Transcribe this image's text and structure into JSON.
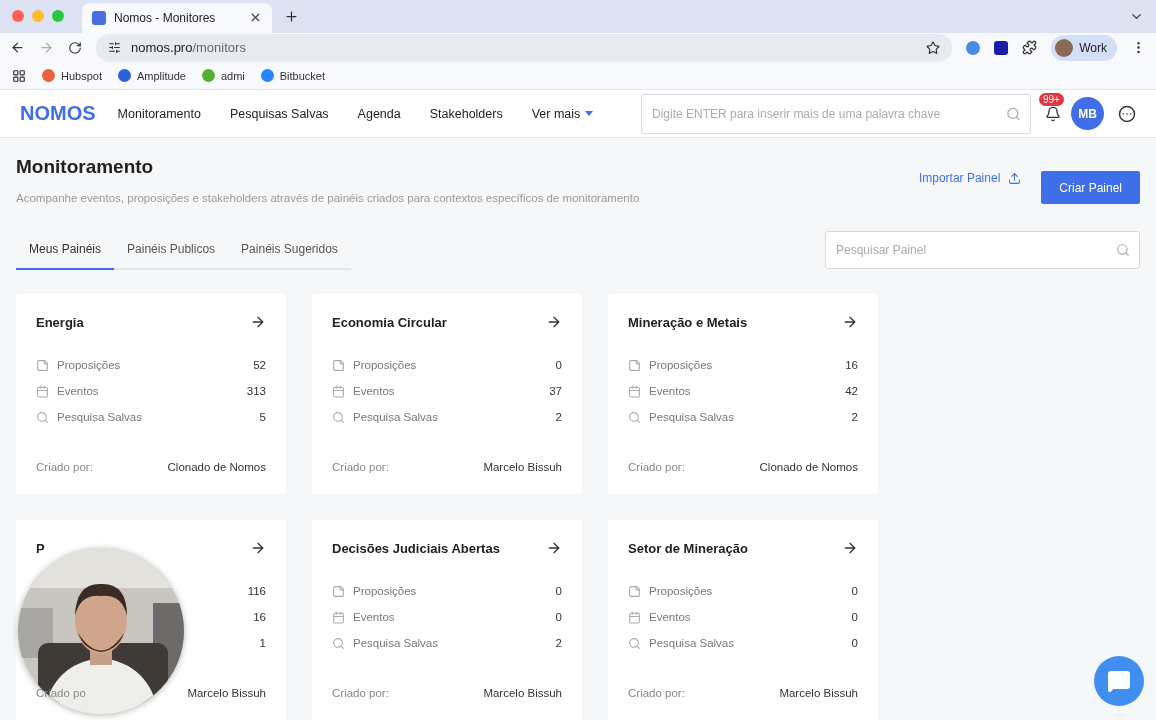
{
  "browser": {
    "tab_title": "Nomos - Monitores",
    "url_host": "nomos.pro",
    "url_path": "/monitors",
    "profile": "Work",
    "bookmarks": [
      {
        "label": "Hubspot",
        "color": "#e8603c"
      },
      {
        "label": "Amplitude",
        "color": "#2a62d9"
      },
      {
        "label": "admi",
        "color": "#55b02f"
      },
      {
        "label": "Bitbucket",
        "color": "#2684ff"
      }
    ]
  },
  "header": {
    "logo": "NOMOS",
    "nav": [
      {
        "label": "Monitoramento",
        "dropdown": false
      },
      {
        "label": "Pesquisas Salvas",
        "dropdown": false
      },
      {
        "label": "Agenda",
        "dropdown": false
      },
      {
        "label": "Stakeholders",
        "dropdown": false
      },
      {
        "label": "Ver mais",
        "dropdown": true
      }
    ],
    "search_placeholder": "Digite ENTER para inserir mais de uma palavra chave",
    "notifications": "99+",
    "avatar": "MB"
  },
  "page": {
    "title": "Monitoramento",
    "subtitle": "Acompanhe eventos, proposições e stakeholders através de painéis criados para contextos específicos de monitoramento",
    "import_button": "Importar Painel",
    "create_button": "Criar Painel",
    "tabs": [
      {
        "label": "Meus Painéis",
        "selected": true
      },
      {
        "label": "Painéis Publicos",
        "selected": false
      },
      {
        "label": "Painéis Sugeridos",
        "selected": false
      }
    ],
    "search_placeholder": "Pesquisar Painel"
  },
  "panels": [
    {
      "title": "Energia",
      "metrics": [
        {
          "kind": "note",
          "label": "Proposições",
          "value": "52"
        },
        {
          "kind": "calendar",
          "label": "Eventos",
          "value": "313"
        },
        {
          "kind": "search",
          "label": "Pesquisa Salvas",
          "value": "5"
        }
      ],
      "creator_label": "Criado por:",
      "creator": "Clonado de Nomos"
    },
    {
      "title": "Economia Circular",
      "metrics": [
        {
          "kind": "note",
          "label": "Proposições",
          "value": "0"
        },
        {
          "kind": "calendar",
          "label": "Eventos",
          "value": "37"
        },
        {
          "kind": "search",
          "label": "Pesquisa Salvas",
          "value": "2"
        }
      ],
      "creator_label": "Criado por:",
      "creator": "Marcelo Bissuh"
    },
    {
      "title": "Mineração e Metais",
      "metrics": [
        {
          "kind": "note",
          "label": "Proposições",
          "value": "16"
        },
        {
          "kind": "calendar",
          "label": "Eventos",
          "value": "42"
        },
        {
          "kind": "search",
          "label": "Pesquisa Salvas",
          "value": "2"
        }
      ],
      "creator_label": "Criado por:",
      "creator": "Clonado de Nomos"
    },
    {
      "title": "P",
      "metrics": [
        {
          "value": "116"
        },
        {
          "value": "16"
        },
        {
          "value": "1"
        }
      ],
      "creator_label": "Criado po",
      "creator": "Marcelo Bissuh"
    },
    {
      "title": "Decisões Judiciais Abertas",
      "metrics": [
        {
          "kind": "note",
          "label": "Proposições",
          "value": "0"
        },
        {
          "kind": "calendar",
          "label": "Eventos",
          "value": "0"
        },
        {
          "kind": "search",
          "label": "Pesquisa Salvas",
          "value": "2"
        }
      ],
      "creator_label": "Criado por:",
      "creator": "Marcelo Bissuh"
    },
    {
      "title": "Setor de Mineração",
      "metrics": [
        {
          "kind": "note",
          "label": "Proposições",
          "value": "0"
        },
        {
          "kind": "calendar",
          "label": "Eventos",
          "value": "0"
        },
        {
          "kind": "search",
          "label": "Pesquisa Salvas",
          "value": "0"
        }
      ],
      "creator_label": "Criado por:",
      "creator": "Marcelo Bissuh"
    }
  ]
}
